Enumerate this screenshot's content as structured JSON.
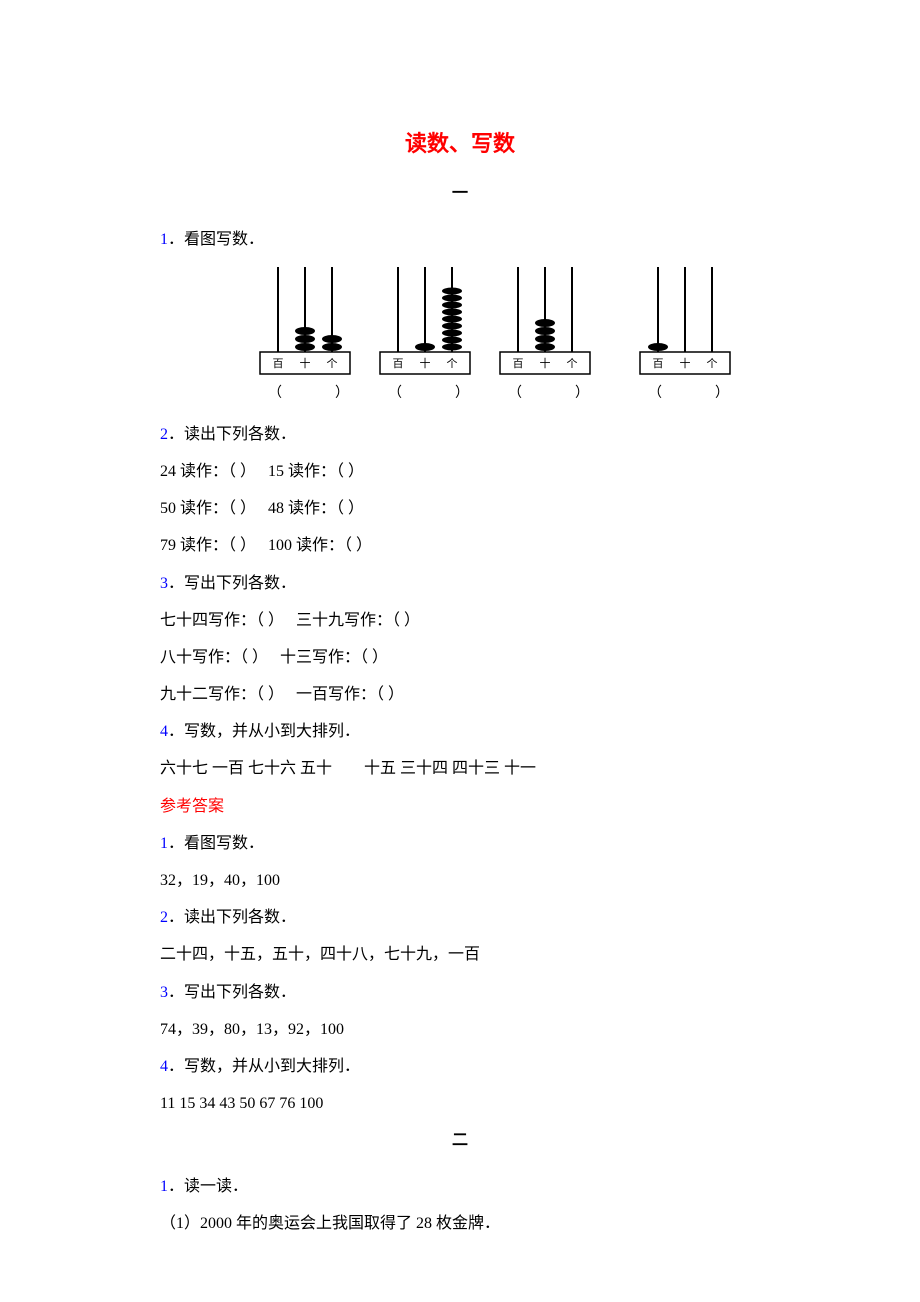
{
  "title": "读数、写数",
  "sections": {
    "one": "一",
    "two": "二"
  },
  "q1": {
    "num": "1",
    "text": "．看图写数．"
  },
  "q2": {
    "num": "2",
    "text": "．读出下列各数．",
    "lines": {
      "a": "24 读作：（ ）　 15 读作：（ ）",
      "b": "50 读作：（ ）　 48 读作：（ ）",
      "c": "79 读作：（ ）　 100 读作：（ ）"
    }
  },
  "q3": {
    "num": "3",
    "text": "．写出下列各数．",
    "lines": {
      "a": "七十四写作：（ ）　 三十九写作：（ ）",
      "b": "八十写作：（ ）　 十三写作：（ ）",
      "c": "九十二写作：（ ）　 一百写作：（ ）"
    }
  },
  "q4": {
    "num": "4",
    "text": "．写数，并从小到大排列．",
    "line": "六十七 一百 七十六 五十　　十五 三十四 四十三 十一"
  },
  "answers": {
    "heading": "参考答案",
    "a1": {
      "num": "1",
      "text": "．看图写数．",
      "ans": "32，19，40，100"
    },
    "a2": {
      "num": "2",
      "text": "．读出下列各数．",
      "ans": "二十四，十五，五十，四十八，七十九，一百"
    },
    "a3": {
      "num": "3",
      "text": "．写出下列各数．",
      "ans": "74，39，80，13，92，100"
    },
    "a4": {
      "num": "4",
      "text": "．写数，并从小到大排列．",
      "ans": "11 15 34 43 50 67 76 100"
    }
  },
  "part2": {
    "q1": {
      "num": "1",
      "text": "．读一读．"
    },
    "line1": "（1）2000 年的奥运会上我国取得了 28 枚金牌．"
  },
  "abacus": {
    "labels": {
      "bai": "百",
      "shi": "十",
      "ge": "个"
    },
    "items": [
      {
        "beads": [
          0,
          3,
          2
        ]
      },
      {
        "beads": [
          0,
          1,
          9
        ]
      },
      {
        "beads": [
          0,
          4,
          0
        ]
      },
      {
        "beads": [
          1,
          0,
          0
        ]
      }
    ]
  }
}
